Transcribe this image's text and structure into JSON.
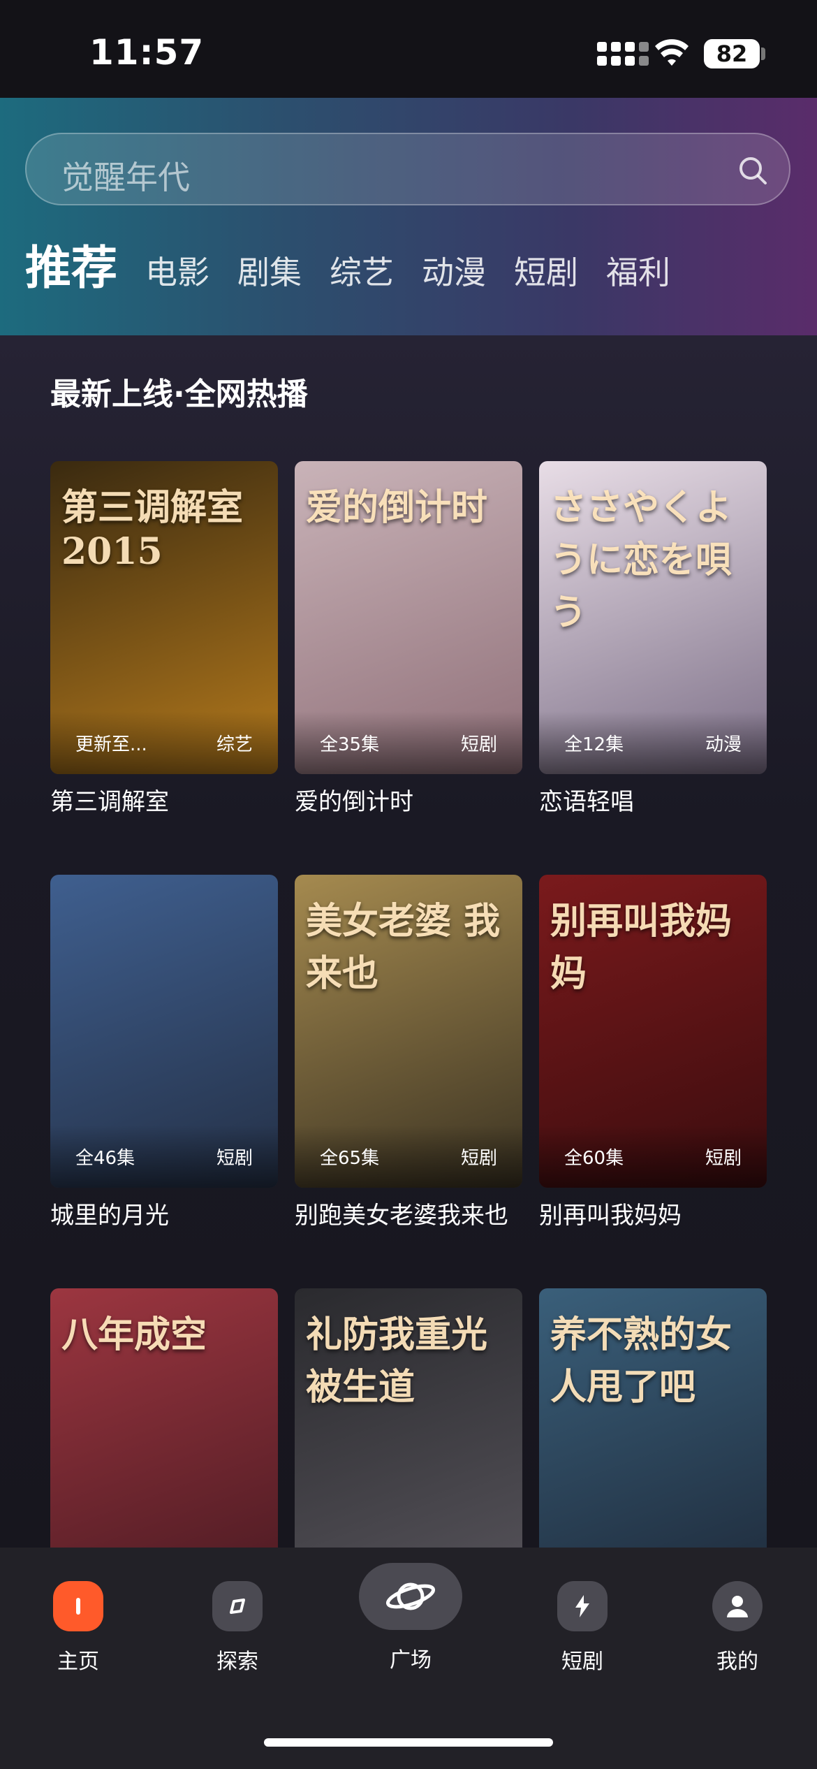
{
  "status": {
    "time": "11:57",
    "battery": "82"
  },
  "search": {
    "placeholder": "觉醒年代"
  },
  "tabs": [
    {
      "label": "推荐",
      "active": true
    },
    {
      "label": "电影"
    },
    {
      "label": "剧集"
    },
    {
      "label": "综艺"
    },
    {
      "label": "动漫"
    },
    {
      "label": "短剧"
    },
    {
      "label": "福利"
    }
  ],
  "section": {
    "title": "最新上线·全网热播"
  },
  "cards": [
    {
      "title": "第三调解室",
      "episodes": "更新至...",
      "genre": "综艺",
      "poster_text": "第三调解室 2015",
      "colors": [
        "#3a2a10",
        "#b57a1c"
      ]
    },
    {
      "title": "爱的倒计时",
      "episodes": "全35集",
      "genre": "短剧",
      "poster_text": "爱的倒计时",
      "colors": [
        "#c9b3b8",
        "#8f6f78"
      ]
    },
    {
      "title": "恋语轻唱",
      "episodes": "全12集",
      "genre": "动漫",
      "poster_text": "ささやくように恋を唄う",
      "colors": [
        "#e8dde6",
        "#7b6e86"
      ]
    },
    {
      "title": "城里的月光",
      "episodes": "全46集",
      "genre": "短剧",
      "poster_text": "",
      "colors": [
        "#3f5f8f",
        "#243046"
      ]
    },
    {
      "title": "别跑美女老婆我来也",
      "episodes": "全65集",
      "genre": "短剧",
      "poster_text": "美女老婆 我来也",
      "colors": [
        "#a58a4f",
        "#3a3222"
      ]
    },
    {
      "title": "别再叫我妈妈",
      "episodes": "全60集",
      "genre": "短剧",
      "poster_text": "别再叫我妈妈",
      "colors": [
        "#7a1a1c",
        "#3a0c0e"
      ]
    },
    {
      "title": "",
      "episodes": "",
      "genre": "",
      "poster_text": "八年成空",
      "colors": [
        "#9c3640",
        "#4a1a22"
      ]
    },
    {
      "title": "",
      "episodes": "",
      "genre": "",
      "poster_text": "礼防我重光被生道",
      "colors": [
        "#2a2a2e",
        "#56535a"
      ]
    },
    {
      "title": "",
      "episodes": "",
      "genre": "",
      "poster_text": "养不熟的女人甩了吧",
      "colors": [
        "#3a5f7a",
        "#1e2a3a"
      ]
    }
  ],
  "nav": [
    {
      "label": "主页",
      "icon": "home-icon",
      "active": true
    },
    {
      "label": "探索",
      "icon": "compass-icon"
    },
    {
      "label": "广场",
      "icon": "planet-icon"
    },
    {
      "label": "短剧",
      "icon": "flash-video-icon"
    },
    {
      "label": "我的",
      "icon": "user-icon"
    }
  ],
  "accent": "#ff5a2a"
}
